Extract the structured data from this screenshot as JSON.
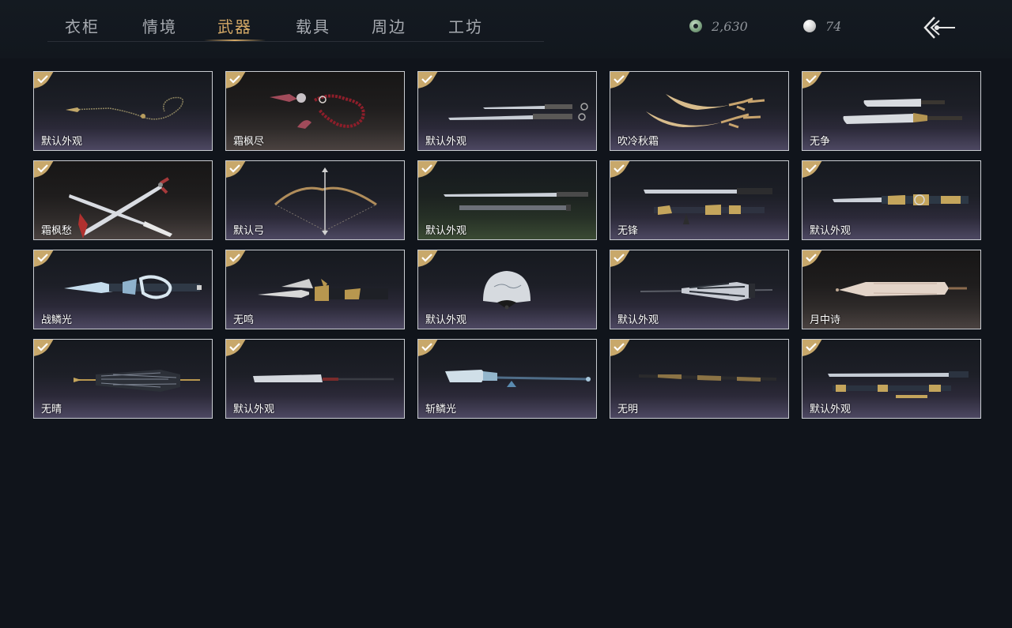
{
  "header": {
    "tabs": [
      {
        "label": "衣柜",
        "active": false
      },
      {
        "label": "情境",
        "active": false
      },
      {
        "label": "武器",
        "active": true
      },
      {
        "label": "载具",
        "active": false
      },
      {
        "label": "周边",
        "active": false
      },
      {
        "label": "工坊",
        "active": false
      }
    ],
    "currency_jade": {
      "icon": "jade-coin-icon",
      "value": "2,630"
    },
    "currency_pearl": {
      "icon": "pearl-icon",
      "value": "74"
    },
    "back_icon": "back-arrow-icon"
  },
  "colors": {
    "active_tab": "#d3a866",
    "badge_gold": "#c8a86b",
    "background": "#10141b"
  },
  "weapons": [
    {
      "label": "默认外观",
      "owned": true,
      "icon": "rope-dart-icon"
    },
    {
      "label": "霜枫尽",
      "owned": true,
      "icon": "meteor-hammer-icon"
    },
    {
      "label": "默认外观",
      "owned": true,
      "icon": "twin-swords-icon"
    },
    {
      "label": "吹冷秋霜",
      "owned": true,
      "icon": "hook-swords-icon"
    },
    {
      "label": "无争",
      "owned": true,
      "icon": "twin-broadswords-icon"
    },
    {
      "label": "霜枫愁",
      "owned": true,
      "icon": "crossed-sabers-icon"
    },
    {
      "label": "默认弓",
      "owned": true,
      "icon": "bow-icon"
    },
    {
      "label": "默认外观",
      "owned": true,
      "icon": "sword-and-sheath-icon"
    },
    {
      "label": "无锋",
      "owned": true,
      "icon": "ornate-sword-icon"
    },
    {
      "label": "默认外观",
      "owned": true,
      "icon": "long-sword-icon"
    },
    {
      "label": "战鳞光",
      "owned": true,
      "icon": "dragon-spear-icon"
    },
    {
      "label": "无鸣",
      "owned": true,
      "icon": "dark-spear-icon"
    },
    {
      "label": "默认外观",
      "owned": true,
      "icon": "folding-fan-icon"
    },
    {
      "label": "默认外观",
      "owned": true,
      "icon": "umbrella-icon"
    },
    {
      "label": "月中诗",
      "owned": true,
      "icon": "paper-umbrella-icon"
    },
    {
      "label": "无晴",
      "owned": true,
      "icon": "black-umbrella-icon"
    },
    {
      "label": "默认外观",
      "owned": true,
      "icon": "glaive-icon"
    },
    {
      "label": "斩鳞光",
      "owned": true,
      "icon": "guandao-icon"
    },
    {
      "label": "无明",
      "owned": true,
      "icon": "staff-icon"
    },
    {
      "label": "默认外观",
      "owned": true,
      "icon": "sword-set-icon"
    }
  ]
}
